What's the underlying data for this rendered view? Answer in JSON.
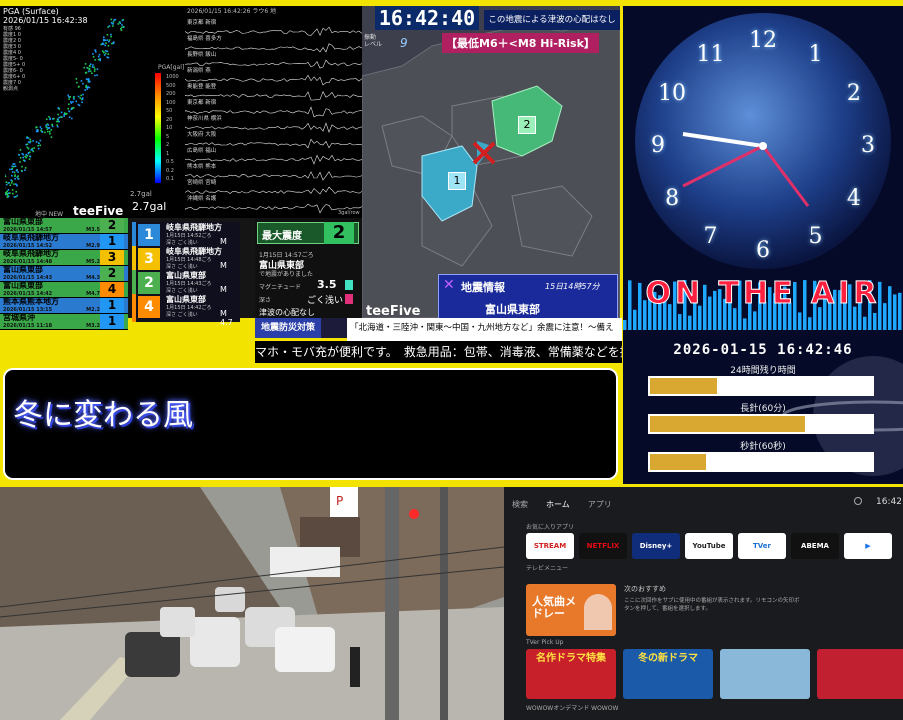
{
  "seismic": {
    "header_line1": "PGA (Surface)",
    "header_line2": "2026/01/15 16:42:38",
    "stats": [
      "有感 96",
      "震度1 0",
      "震度2 0",
      "震度3 0",
      "震度4 0",
      "震度5- 0",
      "震度5+ 0",
      "震度6- 0",
      "震度6+ 0",
      "震度7 0",
      "観測点"
    ],
    "gal_value": "2.7gal",
    "gal_small": "2.7gal",
    "brand": "teeFive",
    "brand_prefix": "地中 NEW",
    "unit_label": "PGA[gal]",
    "scale_ticks": [
      "1000",
      "500",
      "200",
      "100",
      "50",
      "20",
      "10",
      "5",
      "2",
      "1",
      "0.5",
      "0.2",
      "0.1"
    ],
    "wave_header": "2026/01/15 16:42:26 ラウ6 地",
    "wave_labels": [
      "東京都 新宿",
      "福島県 喜多方",
      "長野県 飯山",
      "新潟県 燕",
      "奥能登 能登",
      "東京都 新宿",
      "神奈川県 横浜",
      "大阪府 大阪",
      "広島県 福山",
      "熊本県 熊本",
      "宮崎県 宮崎",
      "沖縄県 名護"
    ],
    "footer_right": "3gal/row"
  },
  "history": {
    "rows": [
      {
        "region": "富山県東部",
        "date": "2026/01/15 14:57",
        "mag": "M3.5",
        "int": "2",
        "color": "#4caf50"
      },
      {
        "region": "岐阜県飛騨地方",
        "date": "2026/01/15 14:52",
        "mag": "M2.9",
        "int": "1",
        "color": "#2196f3"
      },
      {
        "region": "岐阜県飛騨地方",
        "date": "2026/01/15 14:48",
        "mag": "M5.2",
        "int": "3",
        "color": "#f5c000"
      },
      {
        "region": "富山県東部",
        "date": "2026/01/15 14:43",
        "mag": "M4.3",
        "int": "2",
        "color": "#4caf50"
      },
      {
        "region": "富山県東部",
        "date": "2026/01/15 14:42",
        "mag": "M4.7",
        "int": "4",
        "color": "#ff8c00"
      },
      {
        "region": "熊本県熊本地方",
        "date": "2026/01/15 13:15",
        "mag": "M2.2",
        "int": "1",
        "color": "#2196f3"
      },
      {
        "region": "宮城県沖",
        "date": "2026/01/15 11:18",
        "mag": "M3.2",
        "int": "1",
        "color": "#2196f3"
      }
    ],
    "cards": [
      {
        "int": "1",
        "region": "岐阜県飛騨地方",
        "time": "1月15日 14:52ごろ",
        "depth": "深さ ごく浅い",
        "mag": "M 2.9"
      },
      {
        "int": "3",
        "region": "岐阜県飛騨地方",
        "time": "1月15日 14:48ごろ",
        "depth": "深さ ごく浅い",
        "mag": "M 5.2"
      },
      {
        "int": "2",
        "region": "富山県東部",
        "time": "1月15日 14:43ごろ",
        "depth": "深さ ごく浅い",
        "mag": "M 4.3"
      },
      {
        "int": "4",
        "region": "富山県東部",
        "time": "1月15日 14:42ごろ",
        "depth": "深さ ごく浅い",
        "mag": "M 4.7"
      }
    ],
    "card_tag": "最大震度",
    "detail": {
      "label": "最大震度",
      "value": "2",
      "time": "1月15日 14:57ごろ",
      "region": "富山県東部",
      "note": "で地震がありました",
      "mag_label": "マグニチュード",
      "mag_value": "3.5",
      "depth_label": "深さ",
      "depth_value": "ごく浅い",
      "tsunami": "津波の心配なし"
    }
  },
  "map": {
    "clock": "16:42:40",
    "tsunami_msg": "この地震による津波の心配はなし",
    "level_label1": "振動",
    "level_label2": "レベル",
    "level_value": "9",
    "risk_label": "【最低M6＋<M8 Hi-Risk】",
    "brand": "teeFive",
    "info_title": "地震情報",
    "info_time": "15日14時57分",
    "info_region": "富山県東部",
    "markers": [
      "1",
      "2"
    ]
  },
  "band": {
    "label": "地震防災対策",
    "text": "「北海道・三陸沖・関東〜中国・九州地方など」余震に注意！〜備えを〜"
  },
  "ticker": "マホ・モバ充が便利です。　救急用品：包帯、消毒液、常備薬などを揃",
  "lyrics": "冬に変わる風",
  "clock_panel": {
    "numbers": [
      "12",
      "1",
      "2",
      "3",
      "4",
      "5",
      "6",
      "7",
      "8",
      "9",
      "10",
      "11"
    ],
    "onair": "ON THE AIR",
    "datetime": "2026-01-15 16:42:46",
    "bars": [
      {
        "label": "24時間残り時間",
        "fill": 0.3
      },
      {
        "label": "長針(60分)",
        "fill": 0.7
      },
      {
        "label": "秒針(60秒)",
        "fill": 0.25
      }
    ]
  },
  "tv": {
    "nav": [
      "検索",
      "ホーム",
      "アプリ"
    ],
    "time": "16:42",
    "apps_heading": "お気に入りアプリ",
    "apps": [
      {
        "label": "STREAM",
        "bg": "#ffffff",
        "fg": "#d02020"
      },
      {
        "label": "NETFLIX",
        "bg": "#111111",
        "fg": "#e50914"
      },
      {
        "label": "Disney+",
        "bg": "#0f2d7a",
        "fg": "#ffffff"
      },
      {
        "label": "YouTube",
        "bg": "#ffffff",
        "fg": "#222222"
      },
      {
        "label": "TVer",
        "bg": "#ffffff",
        "fg": "#1a6fd0"
      },
      {
        "label": "ABEMA",
        "bg": "#111111",
        "fg": "#ffffff"
      },
      {
        "label": "▶",
        "bg": "#ffffff",
        "fg": "#1a73e8"
      }
    ],
    "menu_label": "テレビメニュー",
    "recommend_heading": "次のおすすめ",
    "recommend_title": "人気曲メドレー",
    "recommend_desc": "ここに次回作をサブに使用中の番組が表示されます。リモコンの矢印ボタンを押して、番組を選択します。",
    "pick_heading": "TVer Pick Up",
    "pick_tiles": [
      "名作ドラマ特集",
      "冬の新ドラマ",
      "",
      ""
    ],
    "footer": "WOWOWオンデマンド WOWOW"
  }
}
